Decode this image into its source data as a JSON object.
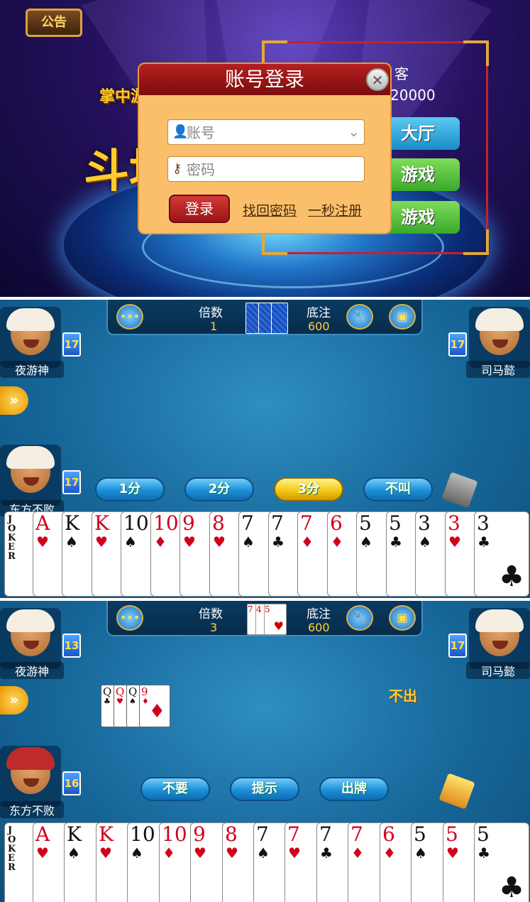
{
  "login": {
    "notice_label": "公告",
    "logo_small": "掌中游",
    "logo_big": "斗地",
    "guest_label": "客",
    "guest_score": "20000",
    "lobby_buttons": [
      "大厅",
      "游戏",
      "游戏"
    ],
    "modal": {
      "title": "账号登录",
      "close_symbol": "✕",
      "account_placeholder": "账号",
      "password_placeholder": "密码",
      "login_button": "登录",
      "forgot_link": "找回密码",
      "register_link": "一秒注册"
    }
  },
  "game1": {
    "multiplier_label": "倍数",
    "multiplier_value": "1",
    "base_label": "底注",
    "base_value": "600",
    "players": {
      "left": {
        "name": "夜游神",
        "cards": "17"
      },
      "right": {
        "name": "司马懿",
        "cards": "17"
      },
      "self": {
        "name": "东方不败",
        "cards": "17"
      }
    },
    "bid_buttons": [
      "1分",
      "2分",
      "3分",
      "不叫"
    ],
    "hand": [
      {
        "rank": "A",
        "suit": "♥",
        "color": "red"
      },
      {
        "rank": "K",
        "suit": "♠",
        "color": "black"
      },
      {
        "rank": "K",
        "suit": "♥",
        "color": "red"
      },
      {
        "rank": "10",
        "suit": "♠",
        "color": "black"
      },
      {
        "rank": "10",
        "suit": "♦",
        "color": "red"
      },
      {
        "rank": "9",
        "suit": "♥",
        "color": "red"
      },
      {
        "rank": "8",
        "suit": "♥",
        "color": "red"
      },
      {
        "rank": "7",
        "suit": "♠",
        "color": "black"
      },
      {
        "rank": "7",
        "suit": "♣",
        "color": "black"
      },
      {
        "rank": "7",
        "suit": "♦",
        "color": "red"
      },
      {
        "rank": "6",
        "suit": "♦",
        "color": "red"
      },
      {
        "rank": "5",
        "suit": "♠",
        "color": "black"
      },
      {
        "rank": "5",
        "suit": "♣",
        "color": "black"
      },
      {
        "rank": "3",
        "suit": "♠",
        "color": "black"
      },
      {
        "rank": "3",
        "suit": "♥",
        "color": "red"
      },
      {
        "rank": "3",
        "suit": "♣",
        "color": "black"
      }
    ],
    "joker_text": "JOKER"
  },
  "game2": {
    "multiplier_label": "倍数",
    "multiplier_value": "3",
    "base_label": "底注",
    "base_value": "600",
    "bottom_cards": [
      "7",
      "4",
      "5"
    ],
    "players": {
      "left": {
        "name": "夜游神",
        "cards": "13"
      },
      "right": {
        "name": "司马懿",
        "cards": "17"
      },
      "self": {
        "name": "东方不败",
        "cards": "16"
      }
    },
    "played_cards": [
      {
        "rank": "Q",
        "suit": "♣",
        "color": "black"
      },
      {
        "rank": "Q",
        "suit": "♥",
        "color": "red"
      },
      {
        "rank": "Q",
        "suit": "♠",
        "color": "black"
      },
      {
        "rank": "9",
        "suit": "♦",
        "color": "red"
      }
    ],
    "right_status": "不出",
    "action_buttons": [
      "不要",
      "提示",
      "出牌"
    ],
    "hand": [
      {
        "rank": "A",
        "suit": "♥",
        "color": "red"
      },
      {
        "rank": "K",
        "suit": "♠",
        "color": "black"
      },
      {
        "rank": "K",
        "suit": "♥",
        "color": "red"
      },
      {
        "rank": "10",
        "suit": "♠",
        "color": "black"
      },
      {
        "rank": "10",
        "suit": "♦",
        "color": "red"
      },
      {
        "rank": "9",
        "suit": "♥",
        "color": "red"
      },
      {
        "rank": "8",
        "suit": "♥",
        "color": "red"
      },
      {
        "rank": "7",
        "suit": "♠",
        "color": "black"
      },
      {
        "rank": "7",
        "suit": "♥",
        "color": "red"
      },
      {
        "rank": "7",
        "suit": "♣",
        "color": "black"
      },
      {
        "rank": "7",
        "suit": "♦",
        "color": "red"
      },
      {
        "rank": "6",
        "suit": "♦",
        "color": "red"
      },
      {
        "rank": "5",
        "suit": "♠",
        "color": "black"
      },
      {
        "rank": "5",
        "suit": "♥",
        "color": "red"
      },
      {
        "rank": "5",
        "suit": "♣",
        "color": "black"
      }
    ],
    "joker_text": "JOKER"
  },
  "icons": {
    "chat": "chat-bubble-icon",
    "settings": "wrench-icon",
    "bag": "treasure-icon",
    "arrow": "double-chevron-right-icon"
  },
  "colors": {
    "table_blue": "#17679a",
    "modal_orange": "#fbbf6b",
    "title_red": "#9b1515",
    "gold": "#ffd23a"
  }
}
